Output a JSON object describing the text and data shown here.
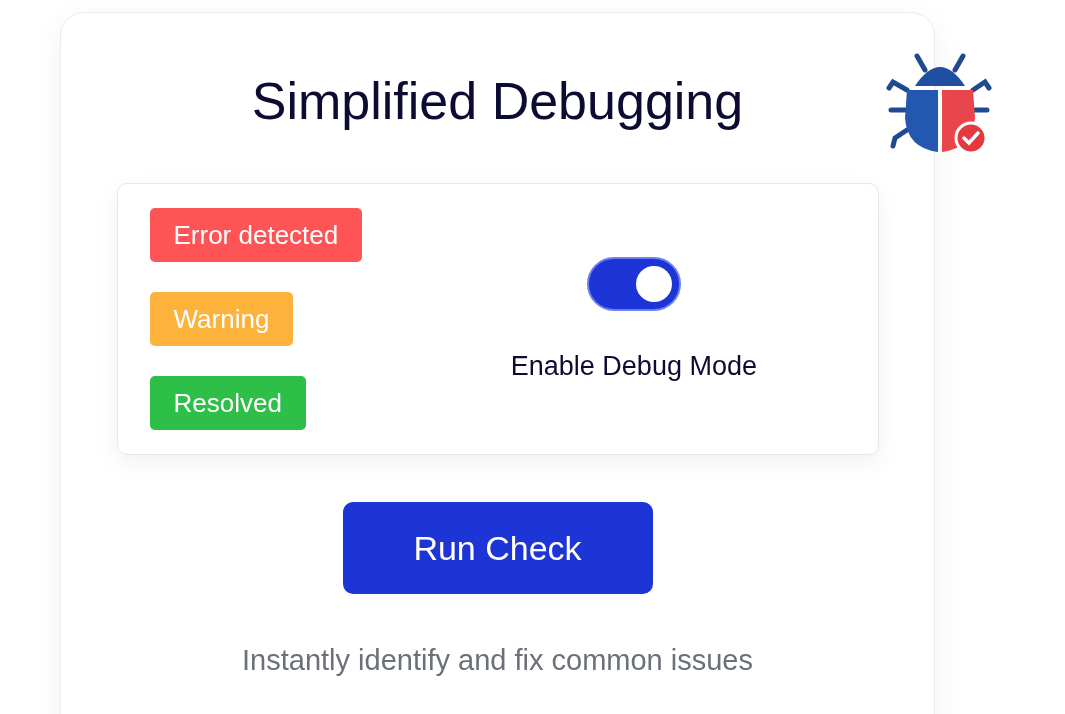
{
  "title": "Simplified Debugging",
  "badges": [
    {
      "label": "Error detected",
      "color": "#fe5455"
    },
    {
      "label": "Warning",
      "color": "#fdb23b"
    },
    {
      "label": "Resolved",
      "color": "#2ebf48"
    }
  ],
  "toggle": {
    "on": true,
    "label": "Enable Debug Mode"
  },
  "button": "Run Check",
  "caption": "Instantly identify and fix common issues"
}
